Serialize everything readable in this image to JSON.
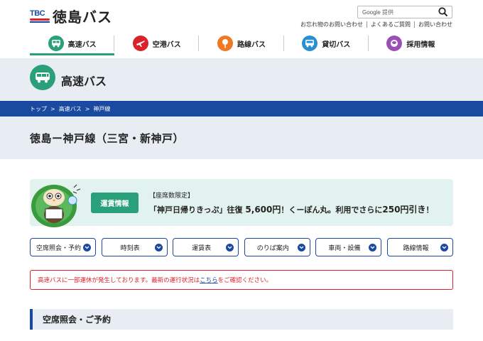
{
  "header": {
    "logo_mark": "TBC",
    "logo_text": "徳島バス",
    "search": {
      "brand": "Google",
      "placeholder": "提供"
    },
    "utility_links": [
      "お忘れ物のお問い合わせ",
      "よくあるご質問",
      "お問い合わせ"
    ]
  },
  "nav": {
    "items": [
      {
        "label": "高速バス",
        "icon": "bus-icon",
        "color": "#2aa07a",
        "active": true
      },
      {
        "label": "空港バス",
        "icon": "airplane-icon",
        "color": "#d9232a",
        "active": false
      },
      {
        "label": "路線バス",
        "icon": "bus-stop-icon",
        "color": "#f07820",
        "active": false
      },
      {
        "label": "貸切バス",
        "icon": "charter-bus-icon",
        "color": "#2a8fd0",
        "active": false
      },
      {
        "label": "採用情報",
        "icon": "person-icon",
        "color": "#9a4fb4",
        "active": false
      }
    ]
  },
  "section": {
    "title": "高速バス",
    "icon": "bus-icon"
  },
  "breadcrumb": [
    "トップ",
    ">",
    "高速バス",
    ">",
    "神戸線"
  ],
  "route_title": "徳島ー神戸線（三宮・新神戸）",
  "promo": {
    "button": "運賃情報",
    "label": "【座席数限定】",
    "text_a": "「神戸日帰りきっぷ」往復",
    "price": "5,600円",
    "text_b": "！くーぽん丸。利用でさらに",
    "discount": "250円引き",
    "text_c": "！"
  },
  "subnav": [
    "空席照会・予約",
    "時刻表",
    "運賃表",
    "のりば案内",
    "車両・設備",
    "路線情報"
  ],
  "alert": {
    "before": "高速バスに一部運休が発生しております。最新の運行状況は",
    "link": "こちら",
    "after": "をご確認ください。"
  },
  "section2_title": "空席照会・ご予約",
  "colors": {
    "brand_blue": "#1a4aa0",
    "green": "#2aa07a",
    "alert_red": "#d9232a",
    "band_gray": "#e8edf3",
    "promo_bg": "#e2f2ee"
  }
}
